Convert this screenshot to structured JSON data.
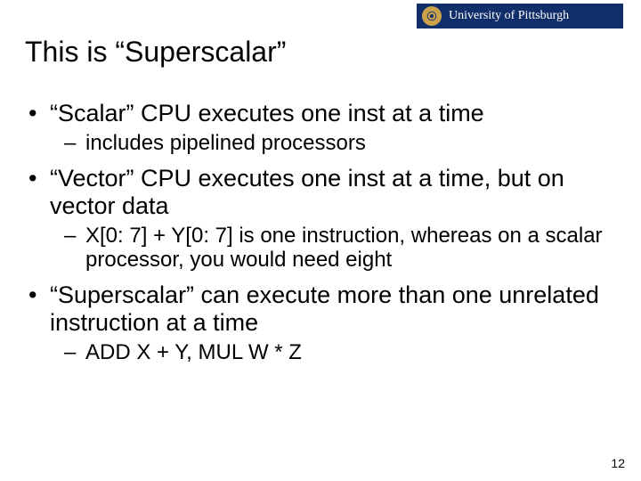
{
  "logo": {
    "text": "University of Pittsburgh",
    "seal_glyph": "⦿"
  },
  "title": "This is “Superscalar”",
  "bullets": [
    {
      "level": 1,
      "text": "“Scalar” CPU executes one inst at a time"
    },
    {
      "level": 2,
      "text": "includes pipelined processors"
    },
    {
      "level": 1,
      "text": "“Vector” CPU executes one inst at a time, but on vector data"
    },
    {
      "level": 2,
      "text": "X[0: 7] + Y[0: 7]  is one instruction, whereas on a scalar processor, you would need eight"
    },
    {
      "level": 1,
      "text": "“Superscalar” can execute more than one unrelated instruction at a time"
    },
    {
      "level": 2,
      "text": "ADD X + Y, MUL W * Z"
    }
  ],
  "page_number": "12"
}
